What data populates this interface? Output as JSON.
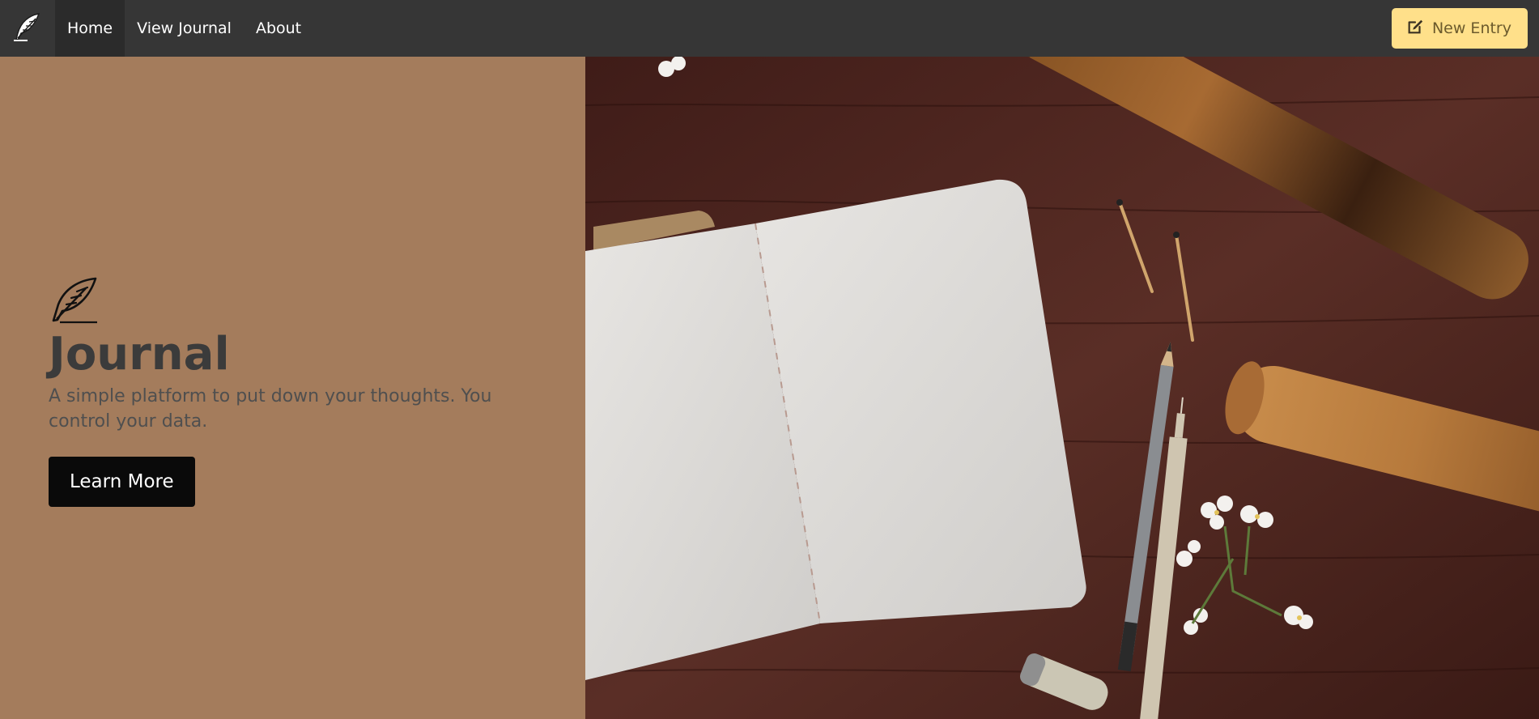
{
  "navbar": {
    "brand_icon": "feather-icon",
    "items": [
      {
        "label": "Home",
        "active": true
      },
      {
        "label": "View Journal",
        "active": false
      },
      {
        "label": "About",
        "active": false
      }
    ],
    "new_entry": {
      "icon": "edit-icon",
      "label": "New Entry"
    }
  },
  "hero": {
    "icon": "feather-icon",
    "title": "Journal",
    "subtitle": "A simple platform to put down your thoughts. You control your data.",
    "cta_label": "Learn More",
    "image": "open-notebook-on-wooden-table"
  },
  "colors": {
    "navbar_bg": "#363636",
    "hero_bg": "#a47c5c",
    "accent_yellow": "#ffe08a",
    "button_dark": "#0a0a0a"
  }
}
